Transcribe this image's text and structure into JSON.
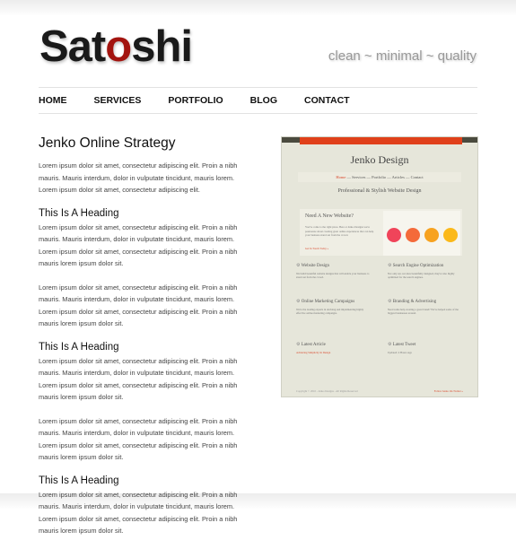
{
  "header": {
    "logo_pre": "Sat",
    "logo_o": "o",
    "logo_post": "shi",
    "tagline": "clean ~ minimal ~ quality"
  },
  "nav": [
    "HOME",
    "SERVICES",
    "PORTFOLIO",
    "BLOG",
    "CONTACT"
  ],
  "main": {
    "title": "Jenko Online Strategy",
    "intro": [
      "Lorem ipsum dolor sit amet, consectetur adipiscing elit. Proin a nibh",
      "mauris. Mauris interdum, dolor in vulputate tincidunt, mauris lorem.",
      "Lorem ipsum dolor sit amet, consectetur adipiscing elit."
    ],
    "sections": [
      {
        "heading": "This Is A Heading",
        "p1": [
          "Lorem ipsum dolor sit amet, consectetur adipiscing elit. Proin a nibh",
          "mauris. Mauris interdum, dolor in vulputate tincidunt, mauris lorem.",
          "Lorem ipsum dolor sit amet, consectetur adipiscing elit. Proin a nibh",
          "mauris lorem ipsum dolor sit."
        ],
        "p2": [
          "Lorem ipsum dolor sit amet, consectetur adipiscing elit. Proin a nibh",
          "mauris. Mauris interdum, dolor in vulputate tincidunt, mauris lorem.",
          "Lorem ipsum dolor sit amet, consectetur adipiscing elit. Proin a nibh",
          "mauris lorem ipsum dolor sit."
        ]
      },
      {
        "heading": "This Is A Heading",
        "p1": [
          "Lorem ipsum dolor sit amet, consectetur adipiscing elit. Proin a nibh",
          "mauris. Mauris interdum, dolor in vulputate tincidunt, mauris lorem.",
          "Lorem ipsum dolor sit amet, consectetur adipiscing elit. Proin a nibh",
          "mauris lorem ipsum dolor sit."
        ],
        "p2": [
          "Lorem ipsum dolor sit amet, consectetur adipiscing elit. Proin a nibh",
          "mauris. Mauris interdum, dolor in vulputate tincidunt, mauris lorem.",
          "Lorem ipsum dolor sit amet, consectetur adipiscing elit. Proin a nibh",
          "mauris lorem ipsum dolor sit."
        ]
      },
      {
        "heading": "This Is A Heading",
        "p1": [
          "Lorem ipsum dolor sit amet, consectetur adipiscing elit. Proin a nibh",
          "mauris. Mauris interdum, dolor in vulputate tincidunt, mauris lorem.",
          "Lorem ipsum dolor sit amet, consectetur adipiscing elit. Proin a nibh",
          "mauris lorem ipsum dolor sit."
        ]
      }
    ]
  },
  "thumbnail": {
    "title": "Jenko Design",
    "nav": [
      "Home",
      "Services",
      "Portfolio",
      "Articles",
      "Contact"
    ],
    "subtitle": "Professional & Stylish Website Design",
    "box_heading": "Need A New Website?",
    "box_text": "You've come to the right place. Here at Jenko Designs we're passionate about creating great online experiences that can help your business stand out from the crowd.",
    "box_link": "Get In Touch Today »",
    "features": [
      {
        "title": "Website Design",
        "text": "We build beautiful website designs that will enable your business to stand out from the crowd."
      },
      {
        "title": "Search Engine Optimization",
        "text": "Not only are our sites beautifully designed, they're also highly optimized for the search engines."
      },
      {
        "title": "Online Marketing Campaigns",
        "text": "We're the leading experts in devising and implementing highly effective online marketing campaigns."
      },
      {
        "title": "Branding & Advertising",
        "text": "Need some help creating a great brand? We've helped some of the biggest businesses around."
      }
    ],
    "latest_article": "Latest Article",
    "article_title": "Achieving Simplicity In Design",
    "latest_tweet": "Latest Tweet",
    "tweet_updated": "Updated: 4 Hours Ago",
    "footer_left": "Copyright © 2010 - Jenko Designs - All Rights Reserved",
    "footer_right": "Follow Jenko On Twitter »",
    "circle_colors": [
      "#f0445a",
      "#f46a3a",
      "#f7a21f",
      "#fbb91a"
    ]
  }
}
